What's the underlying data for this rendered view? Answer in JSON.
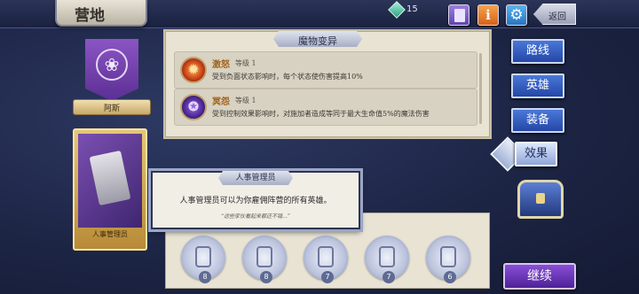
{
  "header": {
    "title": "营地",
    "gem_count": "15",
    "back_label": "返回",
    "icons": [
      "book-icon",
      "info-icon",
      "gear-icon"
    ]
  },
  "left": {
    "faction_label": "阿斯",
    "card_label": "人事管理员"
  },
  "panel": {
    "ribbon": "魔物变异",
    "traits": [
      {
        "name": "激怒",
        "level": "等级 1",
        "desc": "受到负面状态影响时，每个状态使伤害提高10%",
        "icon": "rage-icon"
      },
      {
        "name": "冥怨",
        "level": "等级 1",
        "desc": "受到控制效果影响时，对施加者造成等同于最大生命值5%的魔法伤害",
        "icon": "pentagram-icon"
      }
    ]
  },
  "popup": {
    "title": "人事管理员",
    "desc": "人事管理员可以为你雇佣阵营的所有英雄。",
    "quote": "“这些家伙看起来都还不错...”"
  },
  "emblems": [
    {
      "count": "8",
      "icon": "sword-crest-icon"
    },
    {
      "count": "8",
      "icon": "diamond-crest-icon"
    },
    {
      "count": "7",
      "icon": "wreath-crest-icon"
    },
    {
      "count": "7",
      "icon": "beast-crest-icon"
    },
    {
      "count": "6",
      "icon": "cross-crest-icon"
    }
  ],
  "nav": {
    "route": "路线",
    "hero": "英雄",
    "equip": "装备",
    "effect": "效果",
    "continue": "继续"
  },
  "colors": {
    "background": "#1d2545",
    "nav_button": "#2f5bc0",
    "continue_button": "#6a3bbf",
    "panel": "#e9e3d4"
  }
}
